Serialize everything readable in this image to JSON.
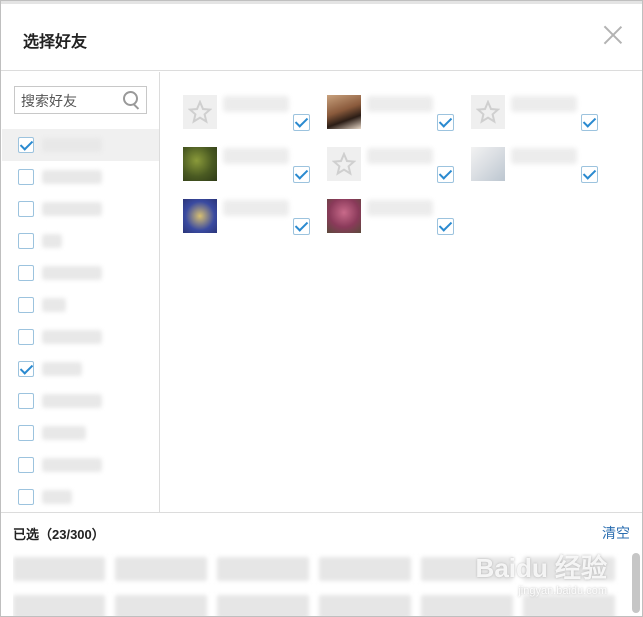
{
  "dialog": {
    "title": "选择好友"
  },
  "search": {
    "placeholder": "搜索好友"
  },
  "friend_list": [
    {
      "checked": true,
      "active": true
    },
    {
      "checked": false
    },
    {
      "checked": false
    },
    {
      "checked": false
    },
    {
      "checked": false
    },
    {
      "checked": false
    },
    {
      "checked": false
    },
    {
      "checked": true
    },
    {
      "checked": false
    },
    {
      "checked": false
    },
    {
      "checked": false
    },
    {
      "checked": false
    }
  ],
  "selected_friends": [
    {
      "avatar": "star-avatar-icon",
      "checked": true
    },
    {
      "avatar": "photo-avatar-icon",
      "checked": true
    },
    {
      "avatar": "star-avatar-icon",
      "checked": true
    },
    {
      "avatar": "photo-avatar-icon",
      "checked": true
    },
    {
      "avatar": "star-avatar-icon",
      "checked": true
    },
    {
      "avatar": "photo-avatar-icon",
      "checked": true
    },
    {
      "avatar": "photo-avatar-icon",
      "checked": true
    },
    {
      "avatar": "photo-avatar-icon",
      "checked": true
    }
  ],
  "footer": {
    "selected_label": "已选（23/300）",
    "clear_label": "清空"
  },
  "watermark": {
    "brand": "Baidu 经验",
    "url": "jingyan.baidu.com"
  },
  "colors": {
    "accent": "#2a8ad0",
    "link": "#2a6db0",
    "border": "#dcdcdc"
  }
}
